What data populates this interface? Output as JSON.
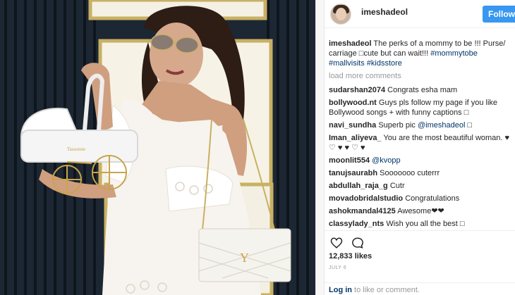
{
  "post": {
    "username": "imeshadeol",
    "follow_label": "Follow",
    "caption": {
      "username": "imeshadeol",
      "text": "The perks of a mommy to be !!! Purse/ carriage □cute but can wait!!!",
      "hashtags": "#mommytobe #mallvisits #kidsstore"
    },
    "load_more": "load more comments",
    "comments": [
      {
        "user": "sudarshan2074",
        "text": "Congrats esha mam"
      },
      {
        "user": "bollywood.nt",
        "text": "Guys pls follow my page if you like Bollywood songs + with funny captions □"
      },
      {
        "user": "navi_sundha",
        "text": "Superb pic ",
        "mention": "@imeshadeol",
        "suffix": " □"
      },
      {
        "user": "Iman_aliyeva_",
        "text": "You are the most beautiful woman. ♥ ♡ ♥ ♥ ♡ ♥"
      },
      {
        "user": "moonlit554",
        "text": "",
        "mention": "@kvopp",
        "suffix": ""
      },
      {
        "user": "tanujsaurabh",
        "text": "Sooooooo cuterrr"
      },
      {
        "user": "abdullah_raja_g",
        "text": "Cutr"
      },
      {
        "user": "movadobridalstudio",
        "text": "Congratulations"
      },
      {
        "user": "ashokmandal4125",
        "text": "Awesome❤❤"
      },
      {
        "user": "classylady_nts",
        "text": "Wish you all the best □"
      }
    ],
    "likes": "12,833 likes",
    "date": "JULY 6",
    "login": {
      "link": "Log in",
      "rest": " to like or comment."
    }
  },
  "icons": {
    "like": "heart-icon",
    "comment": "comment-icon"
  }
}
